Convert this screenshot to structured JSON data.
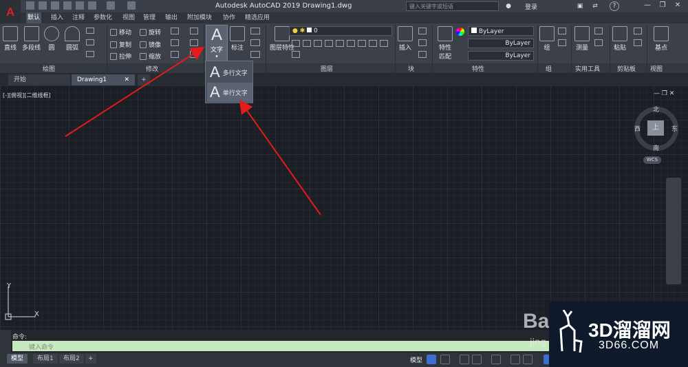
{
  "app": {
    "logo": "A",
    "title": "Autodesk AutoCAD 2019     Drawing1.dwg",
    "search_placeholder": "键入关键字或短语",
    "login": "登录",
    "help": "?"
  },
  "ribbon_tabs": [
    "默认",
    "插入",
    "注释",
    "参数化",
    "视图",
    "管理",
    "输出",
    "附加模块",
    "协作",
    "精选应用"
  ],
  "draw_panel": {
    "line": "直线",
    "polyline": "多段线",
    "circle": "圆",
    "arc": "圆弧",
    "label": "绘图"
  },
  "modify_panel": {
    "move": "移动",
    "rotate": "旋转",
    "copy": "复制",
    "mirror": "镜像",
    "stretch": "拉伸",
    "scale": "缩放",
    "label": "修改"
  },
  "annotation_panel": {
    "text": "文字",
    "dimension": "标注"
  },
  "layer_panel": {
    "layer_props": "图层特性",
    "current_layer": "0",
    "label": "图层"
  },
  "block_panel": {
    "insert": "插入",
    "label": "块"
  },
  "props_panel": {
    "match": "特性匹配",
    "color": "ByLayer",
    "linetype": "ByLayer",
    "lineweight": "ByLayer",
    "label": "特性"
  },
  "group_panel": {
    "group": "组",
    "label": "组"
  },
  "utilities_panel": {
    "measure": "测量",
    "label": "实用工具"
  },
  "clipboard_panel": {
    "paste": "粘贴",
    "label": "剪贴板"
  },
  "view_panel": {
    "base": "基点",
    "label": "视图"
  },
  "file_tabs": {
    "start": "开始",
    "drawing": "Drawing1"
  },
  "viewport_label": "[-][俯视][二维线框]",
  "text_menu": {
    "mtext": "多行文字",
    "single": "单行文字"
  },
  "viewcube": {
    "north": "北",
    "south": "南",
    "east": "东",
    "west": "西",
    "face": "上",
    "wcs": "WCS"
  },
  "ucs": {
    "y": "Y",
    "x": "X"
  },
  "command": {
    "history": "命令:",
    "placeholder": "键入命令"
  },
  "layout_tabs": [
    "模型",
    "布局1",
    "布局2"
  ],
  "status": {
    "model": "模型"
  },
  "watermark": {
    "big": "3D溜溜网",
    "small": "3D66.COM",
    "baidu": "Bai",
    "baidu_sub": "jing"
  }
}
